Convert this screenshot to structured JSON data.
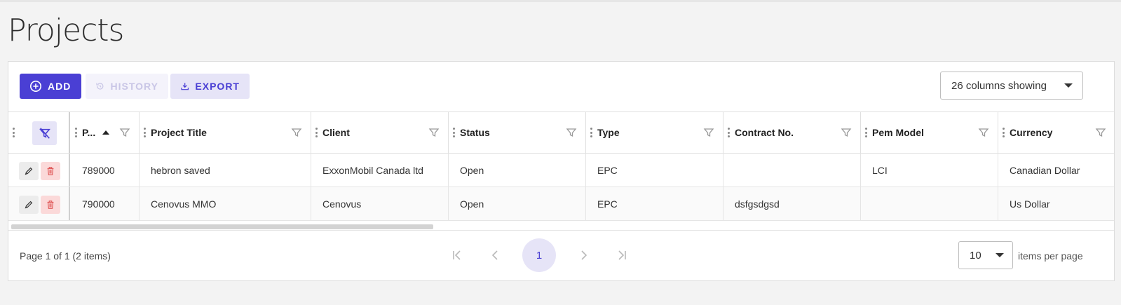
{
  "page": {
    "title": "Projects"
  },
  "toolbar": {
    "add_label": "ADD",
    "history_label": "HISTORY",
    "export_label": "EXPORT",
    "columns_select": "26 columns showing"
  },
  "table": {
    "columns": [
      {
        "label": "P...",
        "sorted": "ascending"
      },
      {
        "label": "Project Title"
      },
      {
        "label": "Client"
      },
      {
        "label": "Status"
      },
      {
        "label": "Type"
      },
      {
        "label": "Contract No."
      },
      {
        "label": "Pem Model"
      },
      {
        "label": "Currency"
      }
    ],
    "rows": [
      [
        "789000",
        "hebron saved",
        "ExxonMobil Canada ltd",
        "Open",
        "EPC",
        "",
        "LCI",
        "Canadian Dollar"
      ],
      [
        "790000",
        "Cenovus MMO",
        "Cenovus",
        "Open",
        "EPC",
        "dsfgsdgsd",
        "",
        "Us Dollar"
      ]
    ]
  },
  "footer": {
    "page_info": "Page 1 of 1 (2 items)",
    "current_page": "1",
    "per_page_value": "10",
    "per_page_label": "items per page"
  },
  "colors": {
    "accent": "#4a3fd4",
    "accent_light": "#e6e4f7",
    "danger_light": "#fbd9d9",
    "danger": "#e05a5a"
  },
  "icons": [
    "plus-circle-icon",
    "history-icon",
    "download-icon",
    "filter-icon",
    "clear-filter-icon",
    "pencil-icon",
    "trash-icon",
    "first-page-icon",
    "prev-page-icon",
    "next-page-icon",
    "last-page-icon"
  ]
}
